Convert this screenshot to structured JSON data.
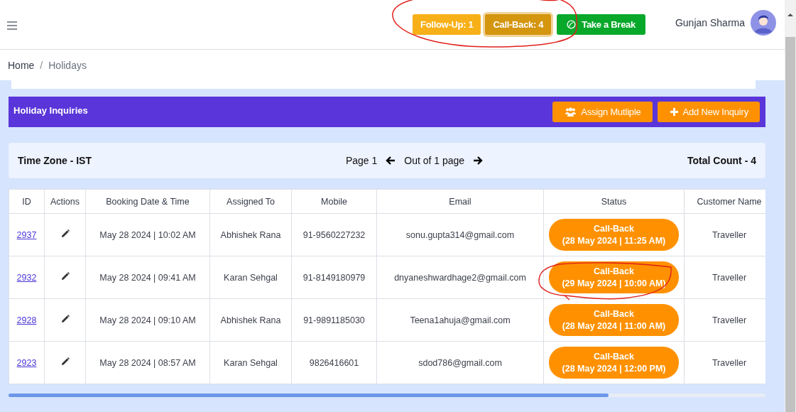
{
  "header": {
    "counters": [
      {
        "label": "Follow-Up: 1",
        "selected": false
      },
      {
        "label": "Call-Back: 4",
        "selected": true
      }
    ],
    "counters_circled": true,
    "break_button": "Take a Break",
    "user_name": "Gunjan Sharma"
  },
  "breadcrumb": {
    "items": [
      "Home",
      "Holidays"
    ],
    "separator": "/"
  },
  "panel": {
    "title": "Holiday Inquiries",
    "buttons": [
      {
        "kind": "users",
        "label": "Assign Mutliple"
      },
      {
        "kind": "plus",
        "label": "Add New Inquiry"
      }
    ]
  },
  "info": {
    "time_zone": "Time Zone - IST",
    "page": "Page 1",
    "out_of": "Out of 1 page",
    "total": "Total Count - 4"
  },
  "table": {
    "columns": [
      "ID",
      "Actions",
      "Booking Date & Time",
      "Assigned To",
      "Mobile",
      "Email",
      "Status",
      "Customer Name"
    ],
    "rows": [
      {
        "id": "2937",
        "booking": "May 28 2024 | 10:02 AM",
        "assigned": "Abhishek Rana",
        "mobile": "91-9560227232",
        "email": "sonu.gupta314@gmail.com",
        "status": "Call-Back",
        "status_time": "(28 May 2024 | 11:25 AM)",
        "circled": false,
        "customer": "Traveller"
      },
      {
        "id": "2932",
        "booking": "May 28 2024 | 09:41 AM",
        "assigned": "Karan Sehgal",
        "mobile": "91-8149180979",
        "email": "dnyaneshwardhage2@gmail.com",
        "status": "Call-Back",
        "status_time": "(29 May 2024 | 10:00 AM)",
        "circled": true,
        "customer": "Traveller"
      },
      {
        "id": "2928",
        "booking": "May 28 2024 | 09:10 AM",
        "assigned": "Abhishek Rana",
        "mobile": "91-9891185030",
        "email": "Teena1ahuja@gmail.com",
        "status": "Call-Back",
        "status_time": "(28 May 2024 | 11:00 AM)",
        "circled": false,
        "customer": "Traveller"
      },
      {
        "id": "2923",
        "booking": "May 28 2024 | 08:57 AM",
        "assigned": "Karan Sehgal",
        "mobile": "9826416601",
        "email": "sdod786@gmail.com",
        "status": "Call-Back",
        "status_time": "(28 May 2024 | 12:00 PM)",
        "circled": false,
        "customer": "Traveller"
      }
    ]
  }
}
